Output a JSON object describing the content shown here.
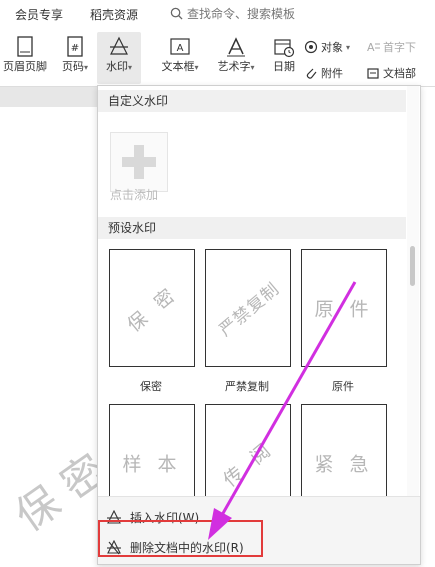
{
  "tabs": [
    "会员专享",
    "稻壳资源"
  ],
  "search": {
    "text": "查找命令、搜索模板"
  },
  "ribbon": {
    "header_footer": "页眉页脚",
    "page_number": "页码",
    "watermark": "水印",
    "textbox": "文本框",
    "art_text": "艺术字",
    "date": "日期",
    "object": "对象",
    "attachment": "附件",
    "drop_cap": "首字下",
    "doc_parts": "文档部"
  },
  "dropdown": {
    "custom_title": "自定义水印",
    "add_label": "点击添加",
    "preset_title": "预设水印",
    "presets": [
      {
        "text": "保 密",
        "label": "保密"
      },
      {
        "text": "严禁复制",
        "label": "严禁复制"
      },
      {
        "text": "原 件",
        "label": "原件"
      },
      {
        "text": "样 本",
        "label": ""
      },
      {
        "text": "传 阅",
        "label": ""
      },
      {
        "text": "紧 急",
        "label": ""
      }
    ],
    "insert_item": "插入水印(W)...",
    "delete_item": "删除文档中的水印(R)"
  },
  "background_stamp": "保 密",
  "colors": {
    "highlight": "#e23b3b",
    "arrow": "#d12fe0"
  }
}
